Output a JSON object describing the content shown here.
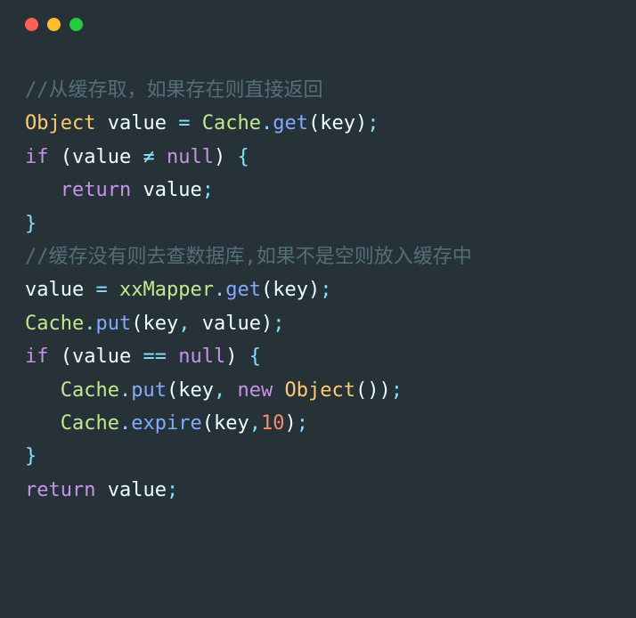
{
  "titlebar": {
    "dots": [
      "red",
      "yellow",
      "green"
    ]
  },
  "code": {
    "line1_comment": "//从缓存取，如果存在则直接返回",
    "line2": {
      "t1": "Object",
      "sp1": " ",
      "t2": "value",
      "sp2": " ",
      "t3": "=",
      "sp3": " ",
      "t4": "Cache",
      "t5": ".",
      "t6": "get",
      "t7": "(",
      "t8": "key",
      "t9": ")",
      "t10": ";"
    },
    "line3": {
      "t1": "if",
      "sp1": " ",
      "t2": "(",
      "t3": "value",
      "sp2": " ",
      "t4": "≠",
      "sp3": " ",
      "t5": "null",
      "t6": ")",
      "sp4": " ",
      "t7": "{"
    },
    "line4": {
      "indent": "   ",
      "t1": "return",
      "sp1": " ",
      "t2": "value",
      "t3": ";"
    },
    "line5": {
      "t1": "}"
    },
    "line6_comment": "//缓存没有则去查数据库,如果不是空则放入缓存中",
    "line7": {
      "t1": "value",
      "sp1": " ",
      "t2": "=",
      "sp2": " ",
      "t3": "xxMapper",
      "t4": ".",
      "t5": "get",
      "t6": "(",
      "t7": "key",
      "t8": ")",
      "t9": ";"
    },
    "line8": {
      "t1": "Cache",
      "t2": ".",
      "t3": "put",
      "t4": "(",
      "t5": "key",
      "t6": ",",
      "sp1": " ",
      "t7": "value",
      "t8": ")",
      "t9": ";"
    },
    "line9": {
      "t1": "if",
      "sp1": " ",
      "t2": "(",
      "t3": "value",
      "sp2": " ",
      "t4": "==",
      "sp3": " ",
      "t5": "null",
      "t6": ")",
      "sp4": " ",
      "t7": "{"
    },
    "line10": {
      "indent": "   ",
      "t1": "Cache",
      "t2": ".",
      "t3": "put",
      "t4": "(",
      "t5": "key",
      "t6": ",",
      "sp1": " ",
      "t7": "new",
      "sp2": " ",
      "t8": "Object",
      "t9": "(",
      "t10": ")",
      "t11": ")",
      "t12": ";"
    },
    "line11": {
      "indent": "   ",
      "t1": "Cache",
      "t2": ".",
      "t3": "expire",
      "t4": "(",
      "t5": "key",
      "t6": ",",
      "t7": "10",
      "t8": ")",
      "t9": ";"
    },
    "line12": {
      "t1": "}"
    },
    "line13": {
      "t1": "return",
      "sp1": " ",
      "t2": "value",
      "t3": ";"
    }
  }
}
